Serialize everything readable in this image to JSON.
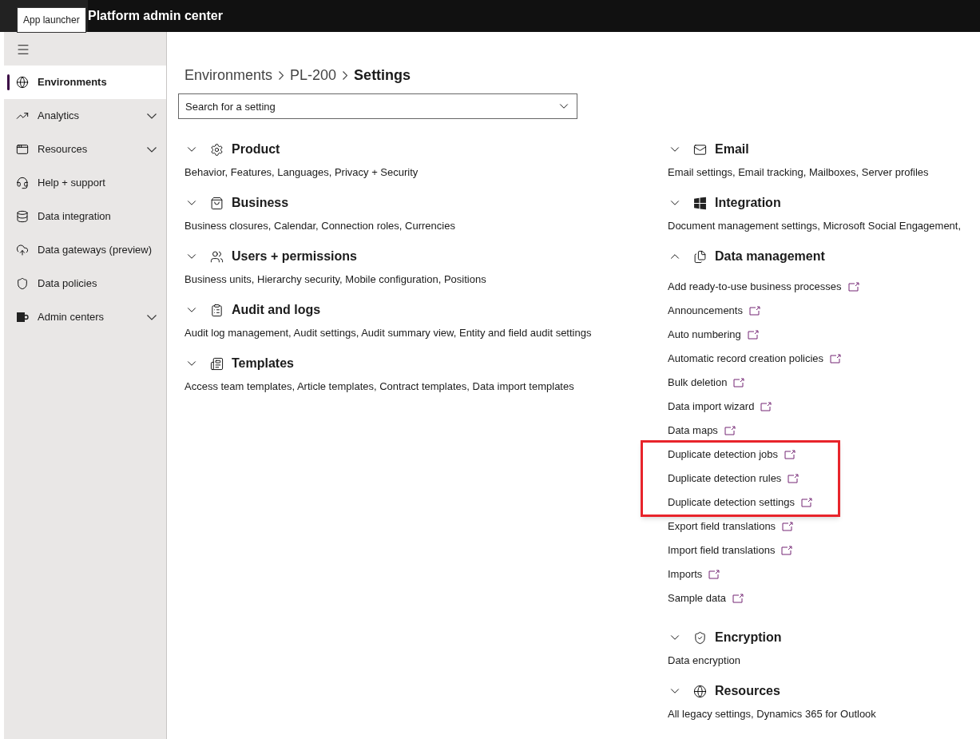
{
  "top_bar": {
    "title": "Platform admin center",
    "tooltip": "App launcher"
  },
  "sidebar": {
    "items": [
      {
        "label": "Environments",
        "selected": true,
        "expandable": false
      },
      {
        "label": "Analytics",
        "selected": false,
        "expandable": true
      },
      {
        "label": "Resources",
        "selected": false,
        "expandable": true
      },
      {
        "label": "Help + support",
        "selected": false,
        "expandable": false
      },
      {
        "label": "Data integration",
        "selected": false,
        "expandable": false
      },
      {
        "label": "Data gateways (preview)",
        "selected": false,
        "expandable": false
      },
      {
        "label": "Data policies",
        "selected": false,
        "expandable": false
      },
      {
        "label": "Admin centers",
        "selected": false,
        "expandable": true
      }
    ]
  },
  "breadcrumb": [
    "Environments",
    "PL-200",
    "Settings"
  ],
  "search": {
    "placeholder": "Search for a setting"
  },
  "columns": [
    [
      {
        "title": "Product",
        "expanded": false,
        "summary": "Behavior, Features, Languages, Privacy + Security"
      },
      {
        "title": "Business",
        "expanded": false,
        "summary": "Business closures, Calendar, Connection roles, Currencies"
      },
      {
        "title": "Users + permissions",
        "expanded": false,
        "summary": "Business units, Hierarchy security, Mobile configuration, Positions"
      },
      {
        "title": "Audit and logs",
        "expanded": false,
        "summary": "Audit log management, Audit settings, Audit summary view, Entity and field audit settings"
      },
      {
        "title": "Templates",
        "expanded": false,
        "summary": "Access team templates, Article templates, Contract templates, Data import templates"
      }
    ],
    [
      {
        "title": "Email",
        "expanded": false,
        "summary": "Email settings, Email tracking, Mailboxes, Server profiles"
      },
      {
        "title": "Integration",
        "expanded": false,
        "summary": "Document management settings, Microsoft Social Engagement,"
      },
      {
        "title": "Data management",
        "expanded": true,
        "links": [
          {
            "label": "Add ready-to-use business processes",
            "highlighted": false
          },
          {
            "label": "Announcements",
            "highlighted": false
          },
          {
            "label": "Auto numbering",
            "highlighted": false
          },
          {
            "label": "Automatic record creation policies",
            "highlighted": false
          },
          {
            "label": "Bulk deletion",
            "highlighted": false
          },
          {
            "label": "Data import wizard",
            "highlighted": false
          },
          {
            "label": "Data maps",
            "highlighted": false
          },
          {
            "label": "Duplicate detection jobs",
            "highlighted": true
          },
          {
            "label": "Duplicate detection rules",
            "highlighted": true
          },
          {
            "label": "Duplicate detection settings",
            "highlighted": true
          },
          {
            "label": "Export field translations",
            "highlighted": false
          },
          {
            "label": "Import field translations",
            "highlighted": false
          },
          {
            "label": "Imports",
            "highlighted": false
          },
          {
            "label": "Sample data",
            "highlighted": false
          }
        ]
      },
      {
        "title": "Encryption",
        "expanded": false,
        "summary": "Data encryption"
      },
      {
        "title": "Resources",
        "expanded": false,
        "summary": "All legacy settings, Dynamics 365 for Outlook"
      }
    ]
  ]
}
